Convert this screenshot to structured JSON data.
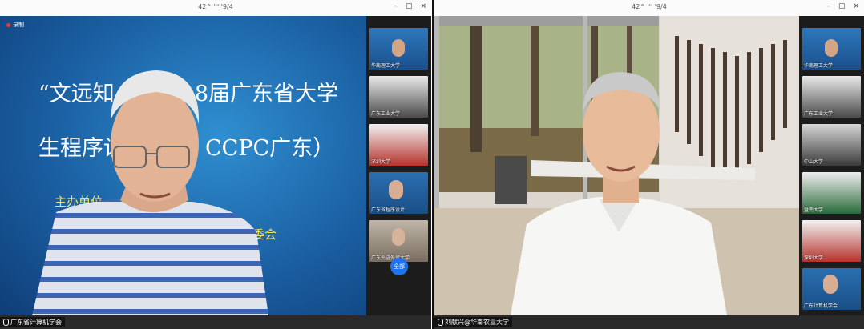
{
  "left_window": {
    "title": "42^ ''' '9/4",
    "controls": [
      "–",
      "▢",
      "×"
    ],
    "recording_label": "录制",
    "slide": {
      "line1": "“文远知",
      "line1b": "8届广东省大学",
      "line2": "生程序设",
      "line2b": "CCPC广东）",
      "org1": "主办单位",
      "org2": "比赛组委会"
    },
    "speaker_name": "广东省计算机学会",
    "thumbnails": [
      {
        "label": "华南理工大学"
      },
      {
        "label": "广东工业大学"
      },
      {
        "label": "深圳大学"
      },
      {
        "label": "广东省程序设计"
      },
      {
        "label": "广东外语外贸大学"
      }
    ],
    "all_button": "全部"
  },
  "right_window": {
    "title": "42^ ''' '9/4",
    "controls": [
      "–",
      "▢",
      "×"
    ],
    "speaker_name": "刘献兴@华南农业大学",
    "thumbnails": [
      {
        "label": "华南理工大学"
      },
      {
        "label": "广东工业大学"
      },
      {
        "label": "中山大学"
      },
      {
        "label": "暨南大学"
      },
      {
        "label": "深圳大学"
      },
      {
        "label": "广东计算机学会"
      }
    ]
  },
  "colors": {
    "slide_blue": "#1a5fa2",
    "slide_yellow": "#f5e46a",
    "all_button": "#1e74f0"
  }
}
